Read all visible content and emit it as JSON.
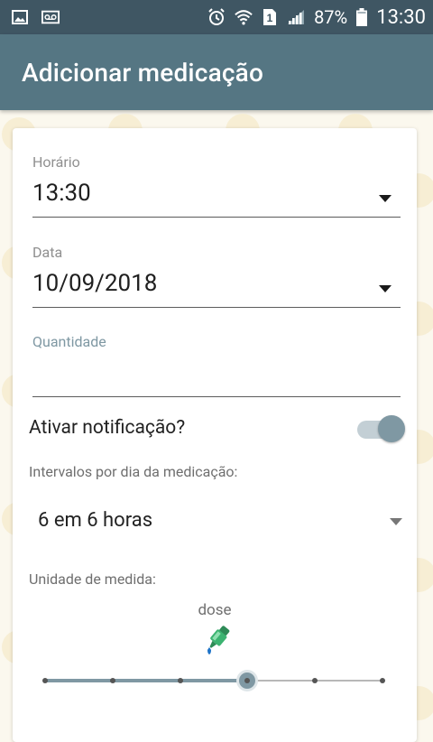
{
  "status_bar": {
    "battery_percent": "87%",
    "time": "13:30",
    "sim_badge": "1",
    "left_icons": [
      "image-icon",
      "voicemail-icon"
    ],
    "right_icons": [
      "alarm-icon",
      "wifi-icon",
      "sim-icon",
      "signal-icon",
      "battery-icon"
    ]
  },
  "app_bar": {
    "title": "Adicionar medicação"
  },
  "form": {
    "horario": {
      "label": "Horário",
      "value": "13:30"
    },
    "data": {
      "label": "Data",
      "value": "10/09/2018"
    },
    "quantidade": {
      "label": "Quantidade",
      "value": ""
    },
    "notificacao": {
      "label": "Ativar notificação?",
      "enabled": true
    },
    "intervalos": {
      "label": "Intervalos por dia da medicação:",
      "selected": "6 em 6 horas"
    },
    "unidade": {
      "label": "Unidade de medida:",
      "selected_name": "dose",
      "icon": "dropper-icon",
      "steps": 6,
      "selected_index": 3
    }
  },
  "colors": {
    "status_bar": "#3f5663",
    "app_bar": "#557683",
    "accent": "#7f98a3"
  }
}
